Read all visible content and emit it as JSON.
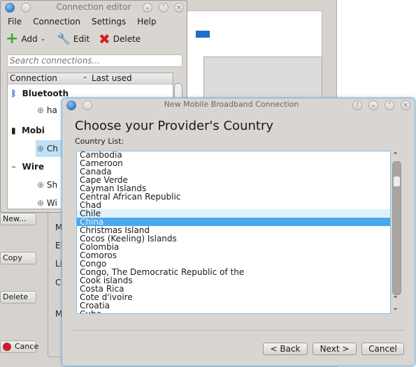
{
  "editor": {
    "title": "Connection editor",
    "menu": [
      "File",
      "Connection",
      "Settings",
      "Help"
    ],
    "toolbar": {
      "add": "Add",
      "edit": "Edit",
      "delete": "Delete"
    },
    "search_placeholder": "Search connections...",
    "columns": {
      "connection": "Connection",
      "last_used": "Last used"
    },
    "tree": [
      {
        "label": "Bluetooth",
        "type": "group",
        "icon": "bluetooth-icon"
      },
      {
        "label": "ha",
        "type": "item"
      },
      {
        "label": "Mobi",
        "type": "group",
        "icon": "mobile-phone-icon"
      },
      {
        "label": "Ch",
        "type": "item",
        "selected": true
      },
      {
        "label": "Wire",
        "type": "group",
        "icon": "wired-icon"
      },
      {
        "label": "Sh",
        "type": "item"
      },
      {
        "label": "Wi",
        "type": "item"
      }
    ]
  },
  "background_window": {
    "buttons": {
      "new": "New...",
      "copy": "Copy",
      "delete": "Delete",
      "cancel": "Cance"
    },
    "labels": [
      "M",
      "El",
      "Li",
      "C",
      "M"
    ]
  },
  "dialog": {
    "title": "New Mobile Broadband Connection",
    "heading": "Choose your Provider's Country",
    "list_label": "Country List:",
    "countries": [
      "Cambodia",
      "Cameroon",
      "Canada",
      "Cape Verde",
      "Cayman Islands",
      "Central African Republic",
      "Chad",
      "Chile",
      "China",
      "Christmas Island",
      "Cocos (Keeling) Islands",
      "Colombia",
      "Comoros",
      "Congo",
      "Congo, The Democratic Republic of the",
      "Cook islands",
      "Costa Rica",
      "Cote d'ivoire",
      "Croatia",
      "Cuba"
    ],
    "selected": "China",
    "hover": "Chile",
    "scroll_position": 0.12,
    "buttons": {
      "back": "< Back",
      "next": "Next >",
      "cancel": "Cancel"
    }
  },
  "colors": {
    "selection": "#4aa8ec",
    "hover": "#dff1fc",
    "accent": "#7cc3e8"
  }
}
